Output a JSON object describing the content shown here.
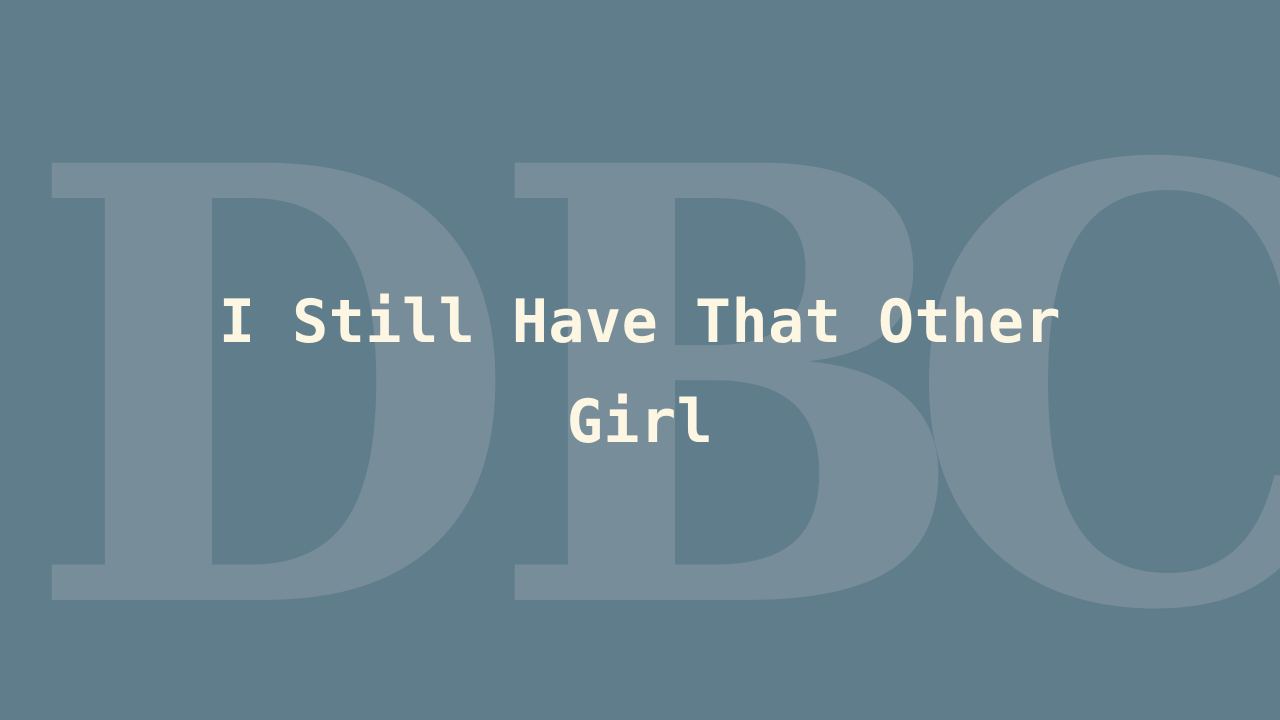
{
  "watermark": {
    "letter_1": "D",
    "letter_2": "B",
    "letter_3": "C"
  },
  "title": "I Still Have That Other Girl",
  "colors": {
    "background": "#607d8b",
    "watermark": "#778d9a",
    "title": "#fdf6e3"
  }
}
